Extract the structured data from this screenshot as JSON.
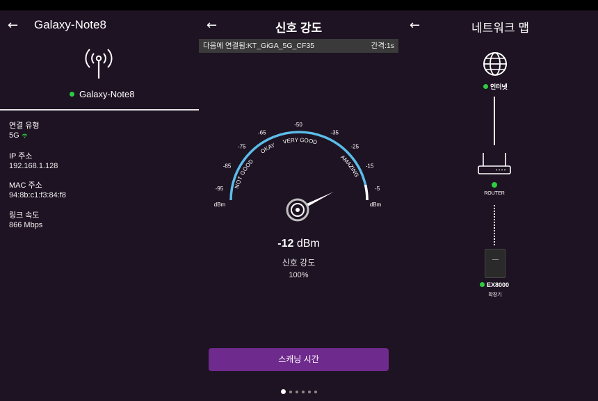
{
  "device": {
    "title": "Galaxy-Note8",
    "status_name": "Galaxy-Note8",
    "status_color": "#2ecc40",
    "fields": [
      {
        "label": "연결 유형",
        "value": "5G"
      },
      {
        "label": "IP 주소",
        "value": "192.168.1.128"
      },
      {
        "label": "MAC 주소",
        "value": "94:8b:c1:f3:84:f8"
      },
      {
        "label": "링크 속도",
        "value": "866 Mbps"
      }
    ]
  },
  "signal": {
    "title": "신호 강도",
    "connected_text": "다음에 연결됨:KT_GiGA_5G_CF35",
    "interval_text": "간격:1s",
    "gauge": {
      "ticks": [
        "-95",
        "-85",
        "-75",
        "-65",
        "-50",
        "-35",
        "-25",
        "-15",
        "-5"
      ],
      "unit_left": "dBm",
      "unit_right": "dBm",
      "zones": [
        "NOT GOOD",
        "OKAY",
        "VERY GOOD",
        "AMAZING"
      ],
      "min": -100,
      "max": 0,
      "value": -12,
      "arc_color": "#5bbde8"
    },
    "reading_value": "-12",
    "reading_unit": " dBm",
    "reading_label": "신호 강도",
    "percent": "100%",
    "scan_button": "스캐닝 시간",
    "pages": 6,
    "active_page": 0
  },
  "network": {
    "title": "네트워크 맵",
    "internet_label": "인터넷",
    "router_label": "ROUTER",
    "extender_label": "EX8000",
    "extender_sub": "확장기"
  },
  "icons": {
    "back": "arrow-left-icon",
    "antenna": "antenna-icon",
    "globe": "globe-icon",
    "router": "router-icon",
    "extender": "extender-icon",
    "wifi": "wifi-icon"
  }
}
